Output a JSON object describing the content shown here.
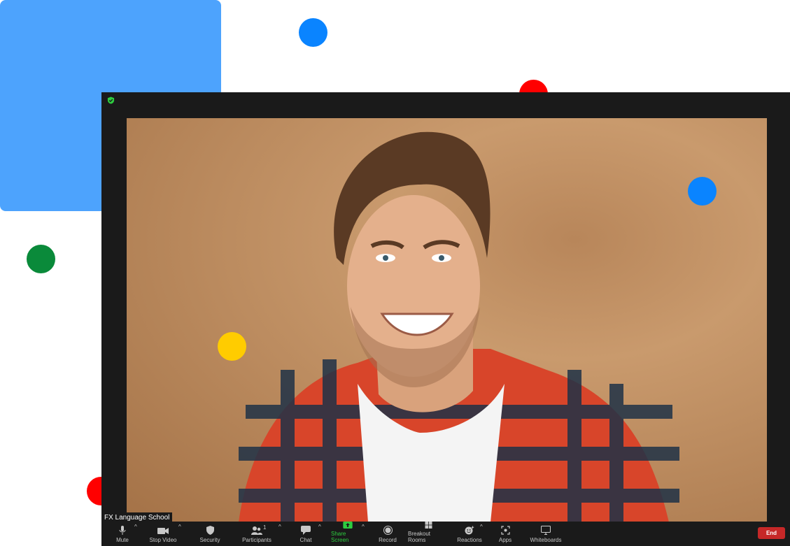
{
  "meeting": {
    "participant_name": "FX Language School",
    "participant_count": "1"
  },
  "toolbar": {
    "mute": "Mute",
    "stop_video": "Stop Video",
    "security": "Security",
    "participants": "Participants",
    "chat": "Chat",
    "share_screen": "Share Screen",
    "record": "Record",
    "breakout_rooms": "Breakout Rooms",
    "reactions": "Reactions",
    "apps": "Apps",
    "whiteboards": "Whiteboards",
    "end": "End"
  },
  "colors": {
    "accent_blue": "#4da3fd",
    "dot_blue": "#0a84ff",
    "dot_red": "#ff0000",
    "dot_green": "#0a8a3a",
    "dot_yellow": "#ffcc00",
    "share_green": "#2ecc40",
    "end_red": "#c62828"
  },
  "icons": [
    "shield-check-icon",
    "microphone-icon",
    "video-camera-icon",
    "shield-icon",
    "participants-icon",
    "chat-bubble-icon",
    "share-screen-icon",
    "record-icon",
    "breakout-rooms-icon",
    "reactions-icon",
    "apps-icon",
    "whiteboard-icon"
  ]
}
